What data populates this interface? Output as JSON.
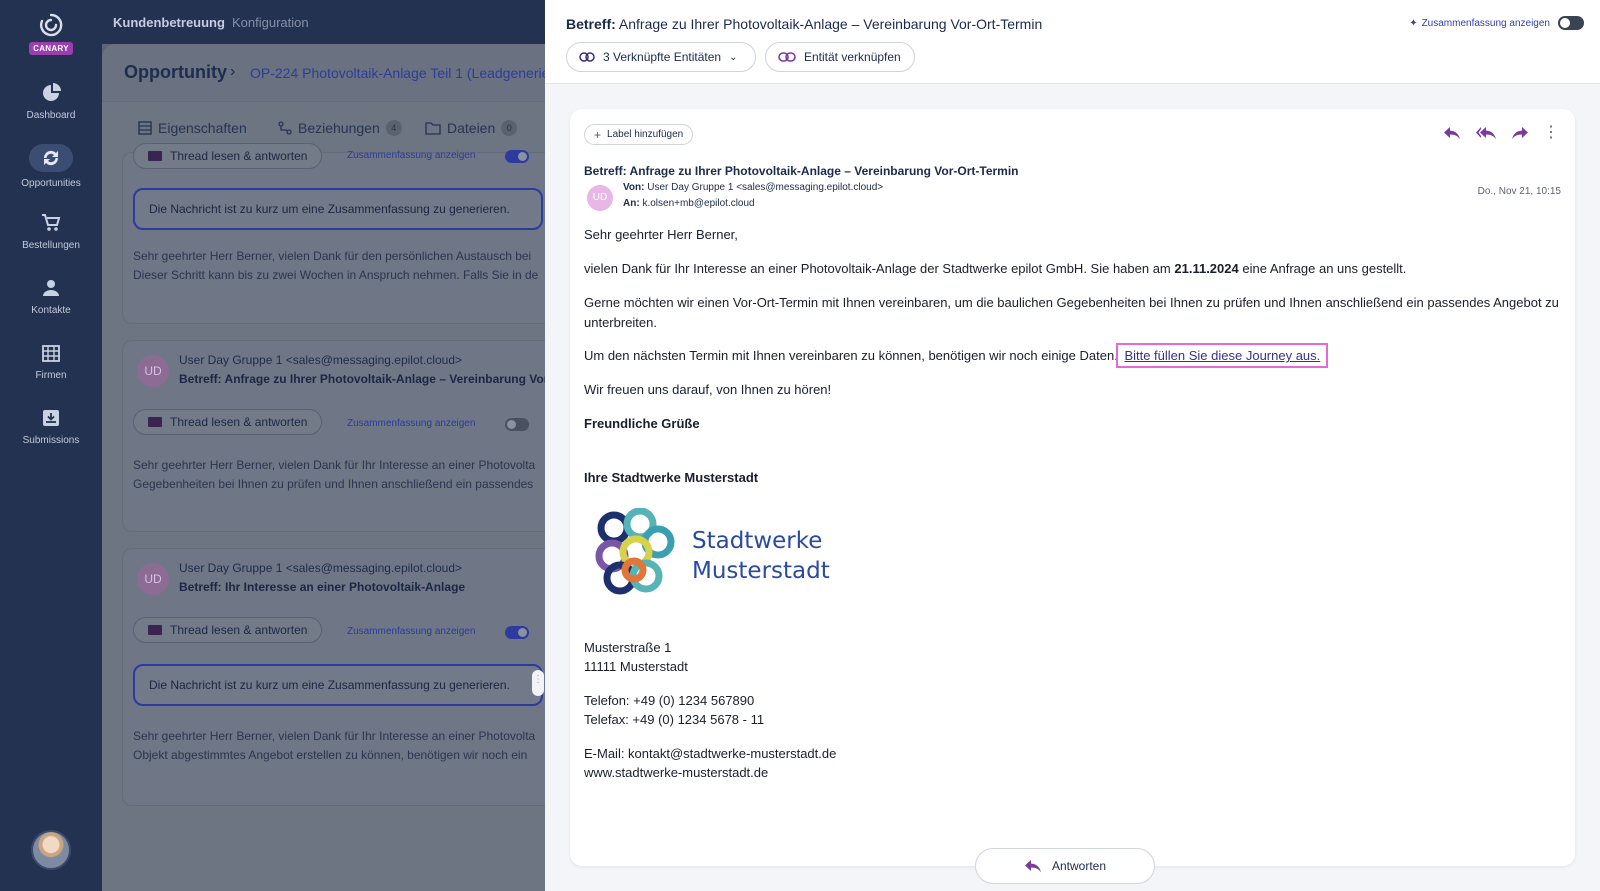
{
  "sidebar": {
    "brand_badge": "CANARY",
    "items": [
      {
        "label": "Dashboard"
      },
      {
        "label": "Opportunities"
      },
      {
        "label": "Bestellungen"
      },
      {
        "label": "Kontakte"
      },
      {
        "label": "Firmen"
      },
      {
        "label": "Submissions"
      }
    ]
  },
  "topnav": {
    "primary": "Kundenbetreuung",
    "secondary": "Konfiguration"
  },
  "background": {
    "title": "Opportunity",
    "breadcrumb": "OP-224 Photovoltaik-Anlage Teil 1 (Leadgenerierung)",
    "tabs": [
      {
        "label": "Eigenschaften"
      },
      {
        "label": "Beziehungen",
        "count": "4"
      },
      {
        "label": "Dateien",
        "count": "0"
      }
    ],
    "thread_button": "Thread lesen & antworten",
    "summary_toggle": "Zusammenfassung anzeigen",
    "too_short": "Die Nachricht ist zu kurz um eine Zusammenfassung zu generieren.",
    "threads": [
      {
        "preview_1": "Sehr geehrter Herr Berner, vielen Dank für den persönlichen Austausch bei",
        "preview_2": "Dieser Schritt kann bis zu zwei Wochen in Anspruch nehmen. Falls Sie in de"
      },
      {
        "avatar": "UD",
        "from": "User Day Gruppe 1 <sales@messaging.epilot.cloud>",
        "subject": "Betreff: Anfrage zu Ihrer Photovoltaik-Anlage – Vereinbarung Vor",
        "preview_1": "Sehr geehrter Herr Berner, vielen Dank für Ihr Interesse an einer Photovolta",
        "preview_2": "Gegebenheiten bei Ihnen zu prüfen und Ihnen anschließend ein passendes"
      },
      {
        "avatar": "UD",
        "from": "User Day Gruppe 1 <sales@messaging.epilot.cloud>",
        "subject": "Betreff: Ihr Interesse an einer Photovoltaik-Anlage",
        "preview_1": "Sehr geehrter Herr Berner, vielen Dank für Ihr Interesse an einer Photovolta",
        "preview_2": "Objekt abgestimmtes Angebot erstellen zu können, benötigen wir noch ein"
      }
    ]
  },
  "drawer": {
    "subject_label": "Betreff:",
    "subject": "Anfrage zu Ihrer Photovoltaik-Anlage – Vereinbarung Vor-Ort-Termin",
    "summary_toggle": "Zusammenfassung anzeigen",
    "linked_entities": "3 Verknüpfte Entitäten",
    "link_entity": "Entität verknüpfen",
    "reply": "Antworten"
  },
  "email": {
    "add_label": "Label hinzufügen",
    "subject": "Betreff: Anfrage zu Ihrer Photovoltaik-Anlage – Vereinbarung Vor-Ort-Termin",
    "avatar": "UD",
    "from_label": "Von:",
    "from": "User Day Gruppe 1 <sales@messaging.epilot.cloud>",
    "to_label": "An:",
    "to": "k.olsen+mb@epilot.cloud",
    "date": "Do., Nov 21, 10:15",
    "greeting": "Sehr geehrter Herr Berner,",
    "p1_a": "vielen Dank für Ihr Interesse an einer Photovoltaik-Anlage der Stadtwerke epilot GmbH. Sie haben am ",
    "p1_date": "21.11.2024",
    "p1_b": " eine Anfrage an uns gestellt.",
    "p2": "Gerne möchten wir einen Vor-Ort-Termin mit Ihnen vereinbaren, um die baulichen Gegebenheiten bei Ihnen zu prüfen und Ihnen anschließend ein passendes Angebot zu unterbreiten.",
    "p3": "Um den nächsten Termin mit Ihnen vereinbaren zu können, benötigen wir noch einige Daten.",
    "link": "Bitte füllen Sie diese Journey aus.",
    "p4": "Wir freuen uns darauf, von Ihnen zu hören!",
    "closing": "Freundliche Grüße",
    "signature": "Ihre Stadtwerke Musterstadt",
    "logo_line1": "Stadtwerke",
    "logo_line2": "Musterstadt",
    "street": "Musterstraße 1",
    "city": "11111 Musterstadt",
    "phone": "Telefon: +49 (0) 1234 567890",
    "fax": "Telefax: +49 (0) 1234 5678 - 11",
    "mail": "E-Mail: kontakt@stadtwerke-musterstadt.de",
    "web": "www.stadtwerke-musterstadt.de"
  },
  "colors": {
    "sidebar": "#243251",
    "accent": "#3040a8",
    "reply_icon": "#7a3aa0",
    "link_outline": "#e46ad9"
  }
}
